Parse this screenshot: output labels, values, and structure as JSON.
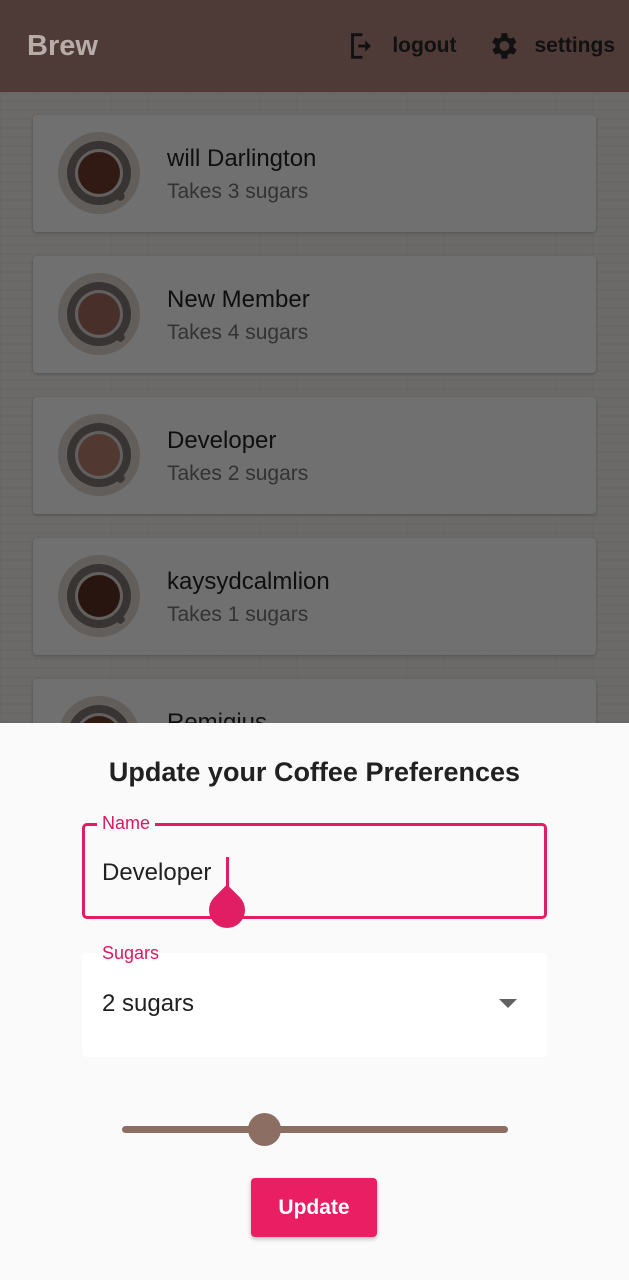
{
  "appbar": {
    "title": "Brew",
    "logout_label": "logout",
    "logout_icon": "logout-icon",
    "settings_label": "settings",
    "settings_icon": "gear-icon"
  },
  "list": {
    "items": [
      {
        "name": "will Darlington",
        "subtitle": "Takes 3 sugars",
        "coffee_color": "#6b3a2a"
      },
      {
        "name": "New Member",
        "subtitle": "Takes 4 sugars",
        "coffee_color": "#a0685a"
      },
      {
        "name": "Developer",
        "subtitle": "Takes 2 sugars",
        "coffee_color": "#b07a6c"
      },
      {
        "name": "kaysydcalmlion",
        "subtitle": "Takes 1 sugars",
        "coffee_color": "#5a2e22"
      },
      {
        "name": "Remigius",
        "subtitle": "",
        "coffee_color": "#6b3a2a"
      }
    ]
  },
  "sheet": {
    "title": "Update your Coffee Preferences",
    "name_field": {
      "label": "Name",
      "value": "Developer"
    },
    "sugars_field": {
      "label": "Sugars",
      "value": "2 sugars"
    },
    "strength_slider": {
      "fraction": 0.37,
      "color": "#8d6e63"
    },
    "update_button": "Update"
  },
  "colors": {
    "appbar": "#4e3a36",
    "accent": "#e91e63"
  }
}
